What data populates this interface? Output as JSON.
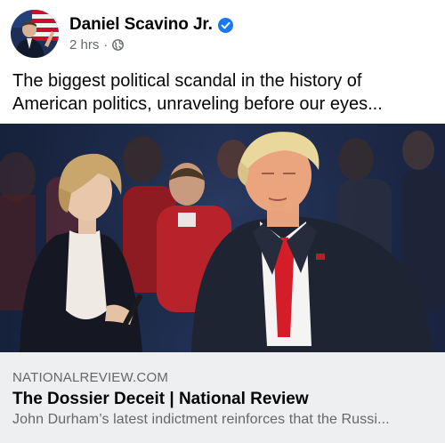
{
  "post": {
    "author": "Daniel Scavino Jr.",
    "verified": true,
    "time": "2 hrs",
    "separator": "·",
    "audience_icon": "globe-icon",
    "text": "The biggest political scandal in the history of American politics, unraveling before our eyes..."
  },
  "link_preview": {
    "domain": "NATIONALREVIEW.COM",
    "title": "The Dossier Deceit | National Review",
    "description": "John Durham’s latest indictment reinforces that the Russi..."
  },
  "colors": {
    "verified_badge": "#1877f2",
    "secondary_text": "#65676b",
    "link_background": "#eeeff1",
    "primary_text": "#050505"
  }
}
